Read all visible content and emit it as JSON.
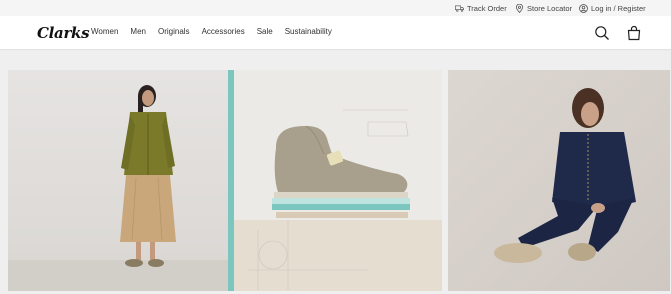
{
  "utility": {
    "track_order": "Track Order",
    "store_locator": "Store Locator",
    "login": "Log in / Register"
  },
  "brand": {
    "logo_text": "Clarks"
  },
  "nav": {
    "items": [
      "Women",
      "Men",
      "Originals",
      "Accessories",
      "Sale",
      "Sustainability"
    ]
  },
  "icons": {
    "track": "truck-icon",
    "store": "location-pin-icon",
    "login": "user-icon",
    "search": "search-icon",
    "bag": "shopping-bag-icon"
  },
  "colors": {
    "accent_teal": "#7cc6c0",
    "olive_jacket": "#7a7a2a",
    "navy_jacket": "#1f2a4a",
    "suede": "#a8a08c"
  }
}
